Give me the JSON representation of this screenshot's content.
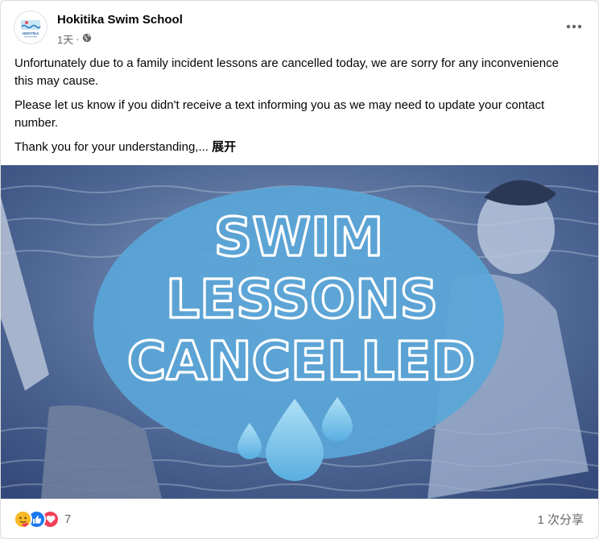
{
  "post": {
    "page_name": "Hokitika Swim School",
    "avatar_text": "HOKITIKA",
    "time": "1天",
    "dot": "·",
    "audience_icon": "globe-icon",
    "more_icon": "more-horizontal-icon",
    "paragraphs": [
      "Unfortunately due to a family incident lessons are cancelled today, we are sorry for any inconvenience this may cause.",
      "Please let us know if you didn't receive a text informing you as we may need to update your contact number."
    ],
    "last_line": "Thank you for your understanding,...",
    "see_more": "展开"
  },
  "image": {
    "lines": [
      "SWIM",
      "LESSONS",
      "CANCELLED"
    ],
    "icon": "water-drops-icon",
    "circle_color": "#5aa6d8",
    "overlay_color": "#3d5c8f"
  },
  "footer": {
    "reaction_icons": [
      "care-emoji-icon",
      "like-icon",
      "love-icon"
    ],
    "reaction_count": "7",
    "share_count": "1 次分享"
  }
}
